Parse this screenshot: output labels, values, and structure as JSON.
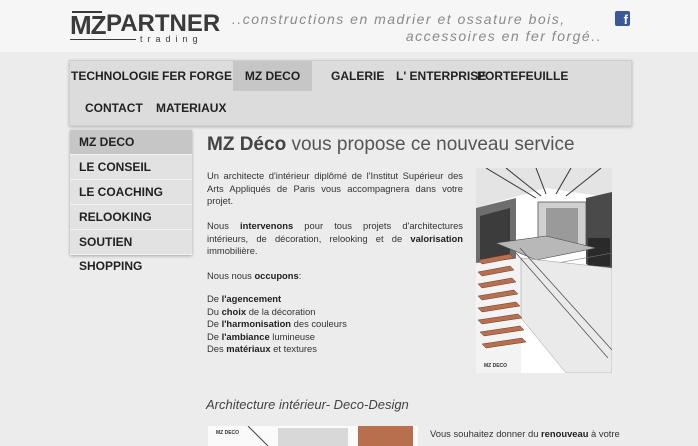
{
  "header": {
    "logo_mz": "MZ",
    "logo_partner": "PARTNER",
    "logo_trading": "trading",
    "tagline_line1": "..constructions en madrier et ossature bois,",
    "tagline_line2": "accessoires en fer forgé..",
    "social_icon": "facebook-icon",
    "social_glyph": "f"
  },
  "nav": {
    "items": [
      {
        "label": "TECHNOLOGIE"
      },
      {
        "label": "FER FORGE"
      },
      {
        "label": "MZ DECO"
      },
      {
        "label": "GALERIE"
      },
      {
        "label": "L' ENTERPRISE"
      },
      {
        "label": "PORTEFEUILLE"
      },
      {
        "label": "CONTACT"
      },
      {
        "label": "MATERIAUX"
      }
    ],
    "active": "MZ DECO"
  },
  "sidebar": {
    "items": [
      {
        "label": "MZ DECO"
      },
      {
        "label": "LE CONSEIL"
      },
      {
        "label": "LE COACHING"
      },
      {
        "label": "RELOOKING"
      },
      {
        "label": "SOUTIEN SHOPPING"
      }
    ],
    "active": "MZ DECO"
  },
  "main": {
    "title_bold": "MZ Déco",
    "title_rest": " vous propose ce nouveau service",
    "p1": "Un architecte d'intérieur diplômé de l'Institut Supérieur des Arts Appliqués de Paris vous accompagnera dans votre projet.",
    "p2_a": "Nous ",
    "p2_b": "intervenons",
    "p2_c": " pour tous projets d'architectures intérieurs, de décoration, relooking et de ",
    "p2_d": "valorisation",
    "p2_e": " immobilière.",
    "p3_a": "Nous nous ",
    "p3_b": "occupons",
    "p3_c": ":",
    "list": [
      {
        "pre": "De ",
        "bold": "l'agencement",
        "post": ""
      },
      {
        "pre": "Du ",
        "bold": "choix",
        "post": " de la décoration"
      },
      {
        "pre": "De ",
        "bold": "l'harmonisation",
        "post": " des couleurs"
      },
      {
        "pre": "De ",
        "bold": "l'ambiance",
        "post": " lumineuse"
      },
      {
        "pre": "Des ",
        "bold": "matériaux",
        "post": " et textures"
      }
    ],
    "sketch_caption": "MZ DECO",
    "subtitle": "Architecture intérieur- Deco-Design",
    "thumb_caption": "MZ DECO",
    "p5_a": "Vous souhaitez donner du ",
    "p5_b": "renouveau",
    "p5_c": " à votre"
  },
  "colors": {
    "background": "#ececec",
    "nav_bg": "#dcdcdc",
    "active_bg": "#c6c6c6",
    "facebook": "#3b5998"
  }
}
